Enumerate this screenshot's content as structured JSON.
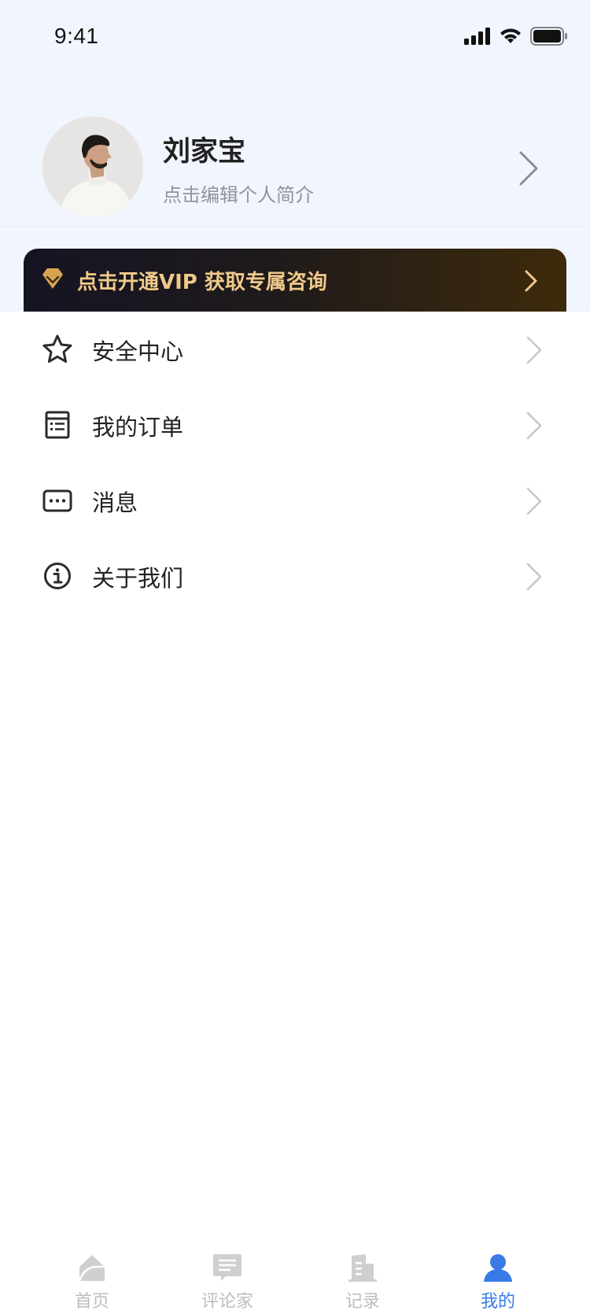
{
  "status_bar": {
    "time": "9:41"
  },
  "profile": {
    "name": "刘家宝",
    "bio": "点击编辑个人简介"
  },
  "vip": {
    "text": "点击开通VIP 获取专属咨询",
    "accent": "#f0c98a"
  },
  "menu": {
    "items": [
      {
        "label": "安全中心",
        "icon": "star-icon"
      },
      {
        "label": "我的订单",
        "icon": "order-list-icon"
      },
      {
        "label": "消息",
        "icon": "message-icon"
      },
      {
        "label": "关于我们",
        "icon": "info-icon"
      }
    ]
  },
  "tab_bar": {
    "active_color": "#3a7ae6",
    "inactive_color": "#bdbdbd",
    "tabs": [
      {
        "label": "首页",
        "icon": "home-icon"
      },
      {
        "label": "评论家",
        "icon": "comment-icon"
      },
      {
        "label": "记录",
        "icon": "building-icon"
      },
      {
        "label": "我的",
        "icon": "user-icon",
        "active": true
      }
    ]
  }
}
